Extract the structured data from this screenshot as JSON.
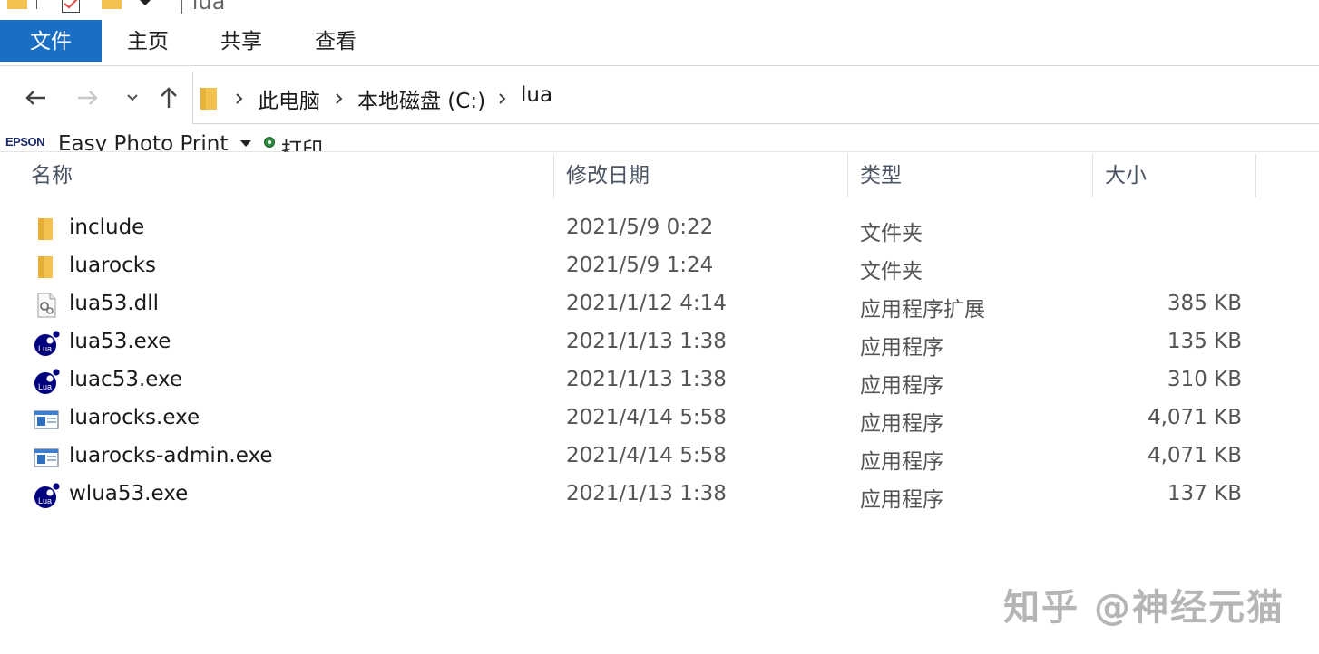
{
  "titlebar": {
    "title": "| lua"
  },
  "ribbon": {
    "tabs": [
      {
        "label": "文件",
        "active": true
      },
      {
        "label": "主页",
        "active": false
      },
      {
        "label": "共享",
        "active": false
      },
      {
        "label": "查看",
        "active": false
      }
    ]
  },
  "address": {
    "breadcrumbs": [
      "此电脑",
      "本地磁盘 (C:)",
      "lua"
    ]
  },
  "epson_toolbar": {
    "logo": "EPSON",
    "app": "Easy Photo Print",
    "print": "打印"
  },
  "columns": {
    "name": "名称",
    "date": "修改日期",
    "type": "类型",
    "size": "大小"
  },
  "files": [
    {
      "name": "include",
      "date": "2021/5/9 0:22",
      "type": "文件夹",
      "size": "",
      "icon": "folder-icon"
    },
    {
      "name": "luarocks",
      "date": "2021/5/9 1:24",
      "type": "文件夹",
      "size": "",
      "icon": "folder-icon"
    },
    {
      "name": "lua53.dll",
      "date": "2021/1/12 4:14",
      "type": "应用程序扩展",
      "size": "385 KB",
      "icon": "dll-icon"
    },
    {
      "name": "lua53.exe",
      "date": "2021/1/13 1:38",
      "type": "应用程序",
      "size": "135 KB",
      "icon": "lua-icon"
    },
    {
      "name": "luac53.exe",
      "date": "2021/1/13 1:38",
      "type": "应用程序",
      "size": "310 KB",
      "icon": "lua-icon"
    },
    {
      "name": "luarocks.exe",
      "date": "2021/4/14 5:58",
      "type": "应用程序",
      "size": "4,071 KB",
      "icon": "exe-icon"
    },
    {
      "name": "luarocks-admin.exe",
      "date": "2021/4/14 5:58",
      "type": "应用程序",
      "size": "4,071 KB",
      "icon": "exe-icon"
    },
    {
      "name": "wlua53.exe",
      "date": "2021/1/13 1:38",
      "type": "应用程序",
      "size": "137 KB",
      "icon": "lua-icon"
    }
  ],
  "lua_icon_text": "Lua",
  "watermark": "知乎 @神经元猫",
  "colors": {
    "accent": "#1a6fc4",
    "folder": "#f2c14e",
    "lua_blue": "#00007f"
  }
}
